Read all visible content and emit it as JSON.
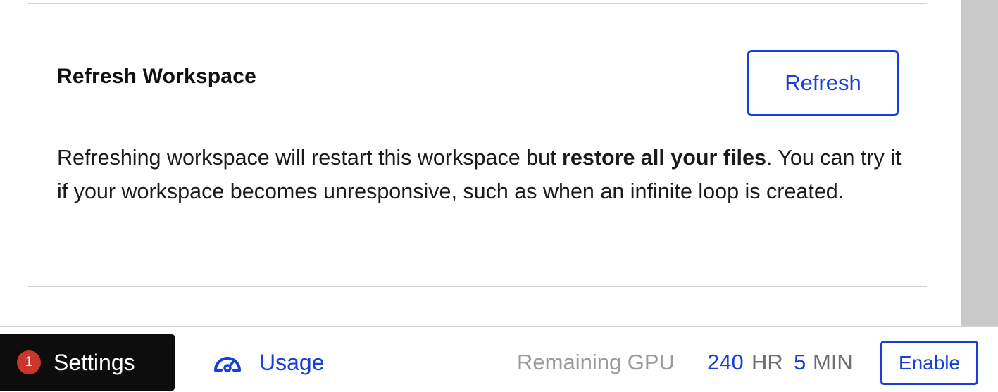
{
  "refresh_section": {
    "title": "Refresh Workspace",
    "button_label": "Refresh",
    "description_part1": "Refreshing workspace will restart this workspace but ",
    "description_bold": "restore all your files",
    "description_part2": ". You can try it if your workspace becomes unresponsive, such as when an infinite loop is created."
  },
  "bottom_bar": {
    "settings": {
      "badge_count": "1",
      "label": "Settings"
    },
    "usage": {
      "icon": "gauge-icon",
      "label": "Usage"
    },
    "gpu": {
      "label": "Remaining GPU",
      "hours": "240",
      "hours_unit": "HR",
      "minutes": "5",
      "minutes_unit": "MIN"
    },
    "enable_label": "Enable"
  },
  "colors": {
    "accent": "#1a3fd6",
    "badge": "#c9372c",
    "settings_bg": "#0d0d0d",
    "muted_text": "#9a9a9a",
    "divider": "#d4d4d4"
  }
}
